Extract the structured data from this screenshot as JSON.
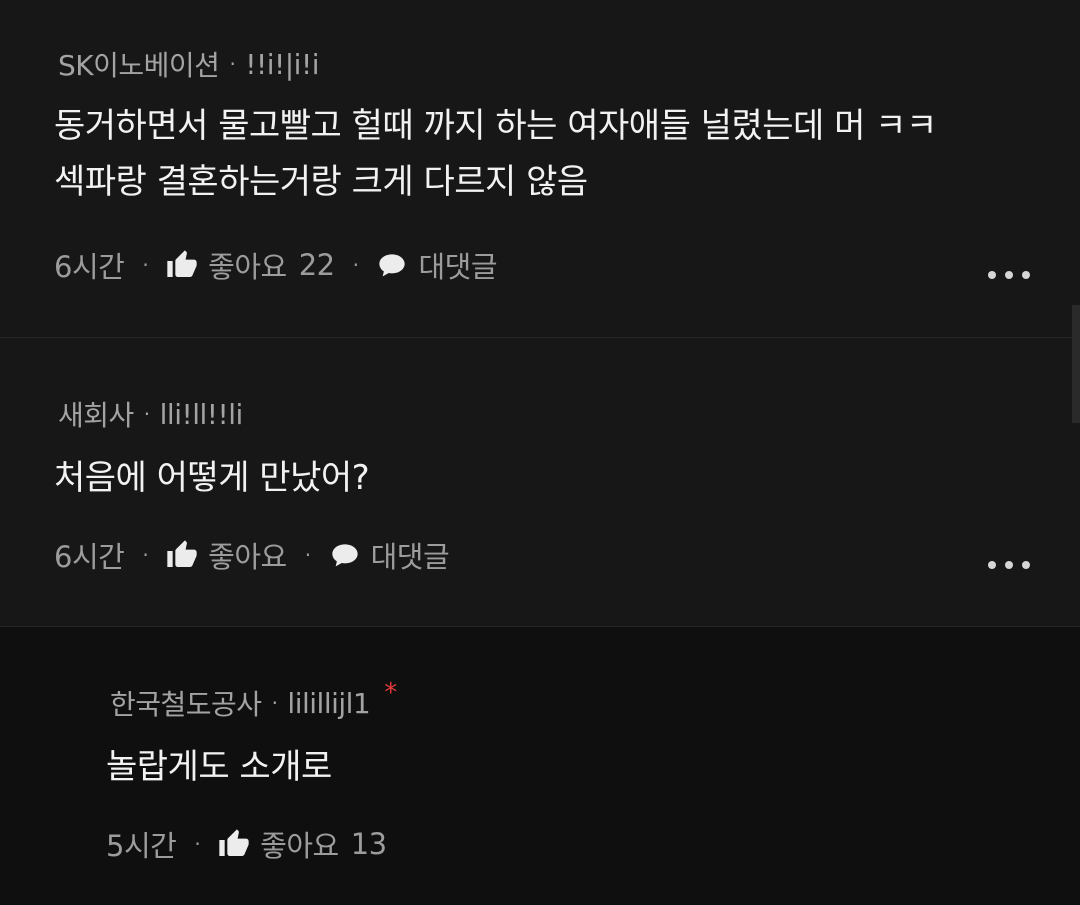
{
  "comments": [
    {
      "company": "SK이노베이션",
      "handle": "!!i!|i!i",
      "lines": [
        "동거하면서 물고빨고 헐때 까지 하는 여자애들 널렸는데 머 ㅋㅋ",
        "섹파랑 결혼하는거랑 크게 다르지 않음"
      ],
      "time": "6시간",
      "like_label": "좋아요",
      "like_count": "22",
      "reply_label": "대댓글"
    },
    {
      "company": "새회사",
      "handle": "lli!ll!!li",
      "lines": [
        "처음에 어떻게 만났어?"
      ],
      "time": "6시간",
      "like_label": "좋아요",
      "reply_label": "대댓글"
    },
    {
      "company": "한국철도공사",
      "handle": "lilillijl1",
      "author_marker": "*",
      "lines": [
        "놀랍게도 소개로"
      ],
      "time": "5시간",
      "like_label": "좋아요",
      "like_count": "13"
    }
  ],
  "separator": "·",
  "icons": {
    "like": "thumbs-up-icon",
    "reply": "speech-bubble-icon",
    "more": "more-horizontal-icon"
  },
  "colors": {
    "background": "#171717",
    "reply_background": "#0f0f0f",
    "text": "#f2f2f2",
    "muted": "#a3a3a3",
    "author_marker": "#e03a3a"
  }
}
